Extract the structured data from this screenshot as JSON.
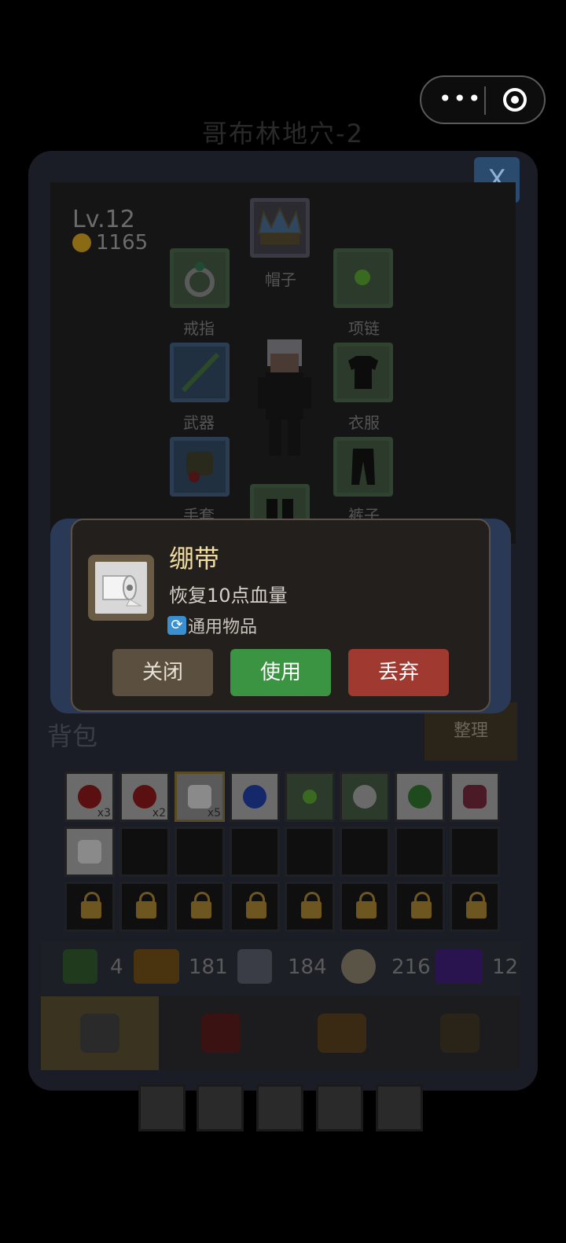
{
  "scene": {
    "title": "哥布林地穴-2"
  },
  "capsule": {
    "more_glyph": "•••"
  },
  "panel": {
    "close_label": "X"
  },
  "player": {
    "level": "Lv.12",
    "gold": "1165"
  },
  "equipment": {
    "hat": "帽子",
    "ring": "戒指",
    "necklace": "项链",
    "weapon": "武器",
    "clothes": "衣服",
    "gloves": "手套",
    "pants": "裤子"
  },
  "item_popup": {
    "name": "绷带",
    "description": "恢复10点血量",
    "category": "通用物品",
    "close_label": "关闭",
    "use_label": "使用",
    "drop_label": "丢弃"
  },
  "backpack": {
    "title": "背包",
    "sort_label": "整理",
    "row1": [
      {
        "icon": "red-potion-icon",
        "count": "x3"
      },
      {
        "icon": "red-potion-icon",
        "count": "x2"
      },
      {
        "icon": "bandage-icon",
        "count": "x5"
      },
      {
        "icon": "blue-potion-icon",
        "count": ""
      },
      {
        "icon": "green-gem-icon",
        "count": ""
      },
      {
        "icon": "skull-mask-icon",
        "count": ""
      },
      {
        "icon": "slime-icon",
        "count": ""
      },
      {
        "icon": "meat-icon",
        "count": ""
      }
    ],
    "row2_first": {
      "icon": "bandage-icon"
    }
  },
  "resources": [
    {
      "icon": "herb-icon",
      "value": "4"
    },
    {
      "icon": "wood-log-icon",
      "value": "181"
    },
    {
      "icon": "iron-ore-icon",
      "value": "184"
    },
    {
      "icon": "yarn-icon",
      "value": "216"
    },
    {
      "icon": "portal-scroll-icon",
      "value": "12"
    }
  ],
  "colors": {
    "use": "#3b9442",
    "drop": "#a03a30",
    "close": "#5b5040",
    "title": "#f0dca0"
  }
}
